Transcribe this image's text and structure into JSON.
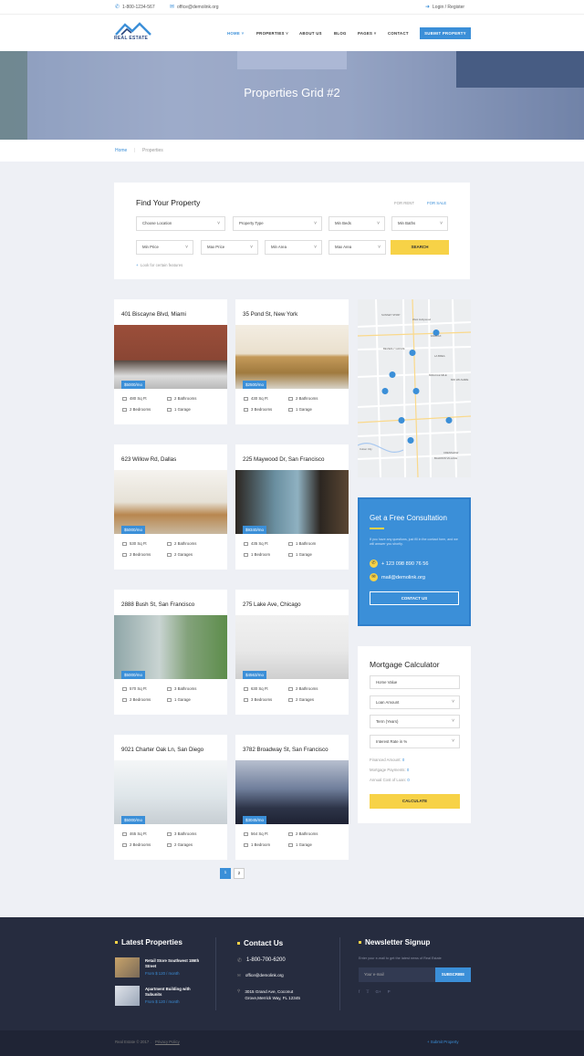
{
  "topbar": {
    "phone": "1-800-1234-567",
    "email": "office@demolink.org",
    "login": "Login / Register"
  },
  "header": {
    "logo_text": "REAL ESTATE",
    "nav": [
      {
        "label": "HOME"
      },
      {
        "label": "PROPERTIES"
      },
      {
        "label": "ABOUT US"
      },
      {
        "label": "BLOG"
      },
      {
        "label": "PAGES"
      },
      {
        "label": "CONTACT"
      }
    ],
    "submit_label": "SUBMIT PROPERTY"
  },
  "hero": {
    "title": "Properties Grid #2"
  },
  "breadcrumb": {
    "home": "Home",
    "current": "Properties"
  },
  "find": {
    "title": "Find Your Property",
    "tab_rent": "FOR RENT",
    "tab_sale": "FOR SALE",
    "location": "Choose Location",
    "type": "Property Type",
    "beds": "Min Beds",
    "baths": "Min Baths",
    "min_price": "Min Price",
    "max_price": "Max Price",
    "min_area": "Min Area",
    "max_area": "Max Area",
    "search": "SEARCH",
    "features": "Look for certain features"
  },
  "properties": [
    {
      "title": "401 Biscayne Blvd, Miami",
      "price": "$5000/mo",
      "area": "480 Sq Ft",
      "baths": "2 Bathrooms",
      "beds": "2 Bedrooms",
      "garage": "1 Garage"
    },
    {
      "title": "35 Pond St, New York",
      "price": "$2500/mo",
      "area": "430 Sq Ft",
      "baths": "2 Bathrooms",
      "beds": "3 Bedrooms",
      "garage": "1 Garage"
    },
    {
      "title": "623 Willow Rd, Dallas",
      "price": "$5000/mo",
      "area": "530 Sq Ft",
      "baths": "2 Bathrooms",
      "beds": "2 Bedrooms",
      "garage": "2 Garages"
    },
    {
      "title": "225 Maywood Dr, San Francisco",
      "price": "$9340/mo",
      "area": "435 Sq Ft",
      "baths": "1 Bathroom",
      "beds": "1 Bedroom",
      "garage": "1 Garage"
    },
    {
      "title": "2888 Bush St, San Francisco",
      "price": "$5000/mo",
      "area": "570 Sq Ft",
      "baths": "3 Bathrooms",
      "beds": "2 Bedrooms",
      "garage": "1 Garage"
    },
    {
      "title": "275 Lake Ave, Chicago",
      "price": "$4563/mo",
      "area": "630 Sq Ft",
      "baths": "2 Bathrooms",
      "beds": "3 Bedrooms",
      "garage": "2 Garages"
    },
    {
      "title": "9021 Charter Oak Ln, San Diego",
      "price": "$5000/mo",
      "area": "465 Sq Ft",
      "baths": "3 Bathrooms",
      "beds": "2 Bedrooms",
      "garage": "2 Garages"
    },
    {
      "title": "3782 Broadway St, San Francisco",
      "price": "$3045/mo",
      "area": "564 Sq Ft",
      "baths": "2 Bathrooms",
      "beds": "1 Bedroom",
      "garage": "1 Garage"
    }
  ],
  "map": {
    "labels": [
      "SUNSET STRIP",
      "West Hollywood",
      "FAIRFAX",
      "BEVERLY GROVE",
      "LA BREA",
      "MIRACLE MILE",
      "MID WILSHIRE",
      "CRENSHAW",
      "BALDWIN VILLAGE",
      "Culver City"
    ]
  },
  "consult": {
    "title": "Get a Free Consultation",
    "text": "If you have any questions, just fill in the contact form, and we will answer you shortly.",
    "phone": "+ 123 098 890 76 56",
    "email": "mail@demolink.org",
    "button": "CONTACT US"
  },
  "mortgage": {
    "title": "Mortgage Calculator",
    "home_value": "Home Value",
    "loan": "Loan Amount",
    "term": "Term (Years)",
    "rate": "Interest Rate in %",
    "financed": "Financed Amount:",
    "financed_val": "0",
    "payments": "Mortgage Payments:",
    "payments_val": "0",
    "annual": "Annual Cost of Loan:",
    "annual_val": "0",
    "button": "CALCULATE"
  },
  "pagination": [
    "1",
    "2"
  ],
  "footer": {
    "latest_title": "Latest Properties",
    "latest": [
      {
        "name": "Retail Store Southwest 186th Street",
        "price": "From $ 120 / month"
      },
      {
        "name": "Apartment Building with Subunits",
        "price": "From $ 120 / month"
      }
    ],
    "contact_title": "Contact Us",
    "phone": "1-800-700-6200",
    "email": "office@demolink.org",
    "address": "3015 Grand Ave, Coconut Grove,Merrick Way, FL 12345",
    "news_title": "Newsletter Signup",
    "news_text": "Enter your e-mail to get the latest news of Real Estate",
    "email_placeholder": "Your e-mail",
    "subscribe": "SUBSCRIBE",
    "copyright": "Real Estate © 2017 .",
    "privacy": "Privacy Policy",
    "submit": "Submit Property"
  },
  "colors": {
    "accent": "#3b8fd8",
    "yellow": "#f7d247",
    "footer": "#262c3f"
  }
}
